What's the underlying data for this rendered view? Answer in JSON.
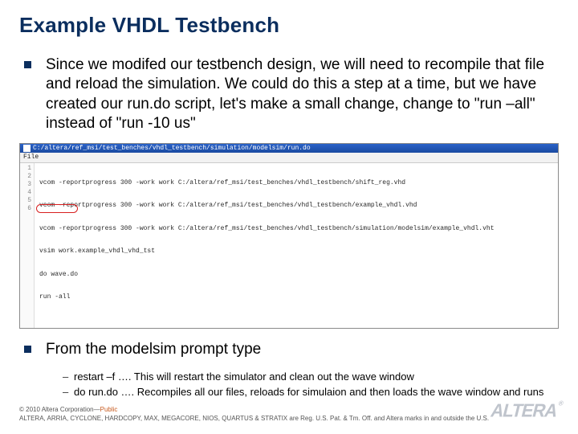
{
  "title": "Example VHDL Testbench",
  "bullets": {
    "b1": "Since we modifed our testbench design, we will need to recompile that file and reload the simulation.  We could do this a step at a time,  but we have created our run.do script, let's make a small change, change to \"run –all\" instead  of \"run -10 us\"",
    "b2": "From the modelsim prompt type"
  },
  "sub": {
    "s1": "restart –f     …. This will restart the simulator and clean out the wave window",
    "s2": "do run.do  …. Recompiles all our files, reloads for simulaion and then loads the wave window and runs"
  },
  "editor": {
    "titlebar_path": "C:/altera/ref_msi/test_benches/vhdl_testbench/simulation/modelsim/run.do",
    "menu": "File",
    "lines": {
      "ln1": "1",
      "ln2": "2",
      "ln3": "3",
      "ln4": "4",
      "ln5": "5",
      "ln6": "6",
      "c1": "vcom -reportprogress 300 -work work C:/altera/ref_msi/test_benches/vhdl_testbench/shift_reg.vhd",
      "c2": "vcom -reportprogress 300 -work work C:/altera/ref_msi/test_benches/vhdl_testbench/example_vhdl.vhd",
      "c3": "vcom -reportprogress 300 -work work C:/altera/ref_msi/test_benches/vhdl_testbench/simulation/modelsim/example_vhdl.vht",
      "c4": "vsim work.example_vhdl_vhd_tst",
      "c5": "do wave.do",
      "c6": "run -all"
    }
  },
  "footer": {
    "line1_a": "© 2010 Altera Corporation—",
    "line1_b": "Public",
    "line2": "ALTERA, ARRIA, CYCLONE, HARDCOPY, MAX, MEGACORE, NIOS, QUARTUS & STRATIX are Reg. U.S. Pat. & Tm. Off. and Altera marks in and outside the U.S."
  },
  "logo": {
    "text": "ALTERA",
    "reg": "®"
  }
}
